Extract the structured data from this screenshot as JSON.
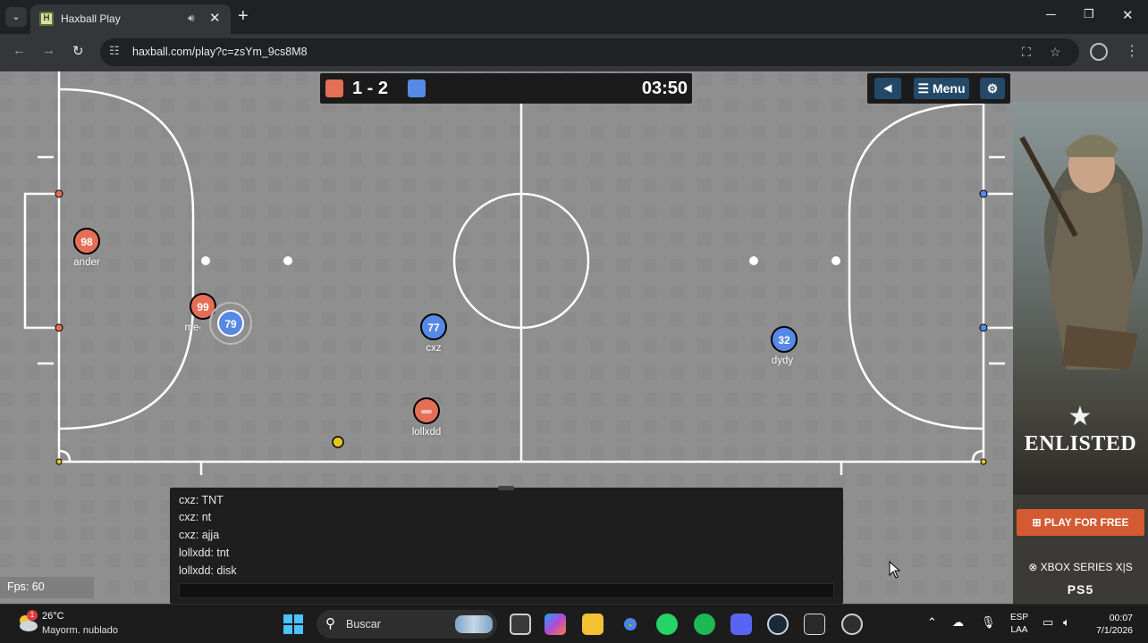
{
  "browser": {
    "tab_title": "Haxball Play",
    "tab_favicon_letter": "H",
    "url": "haxball.com/play?c=zsYm_9cs8M8"
  },
  "game": {
    "score_text": "1 - 2",
    "time": "03:50",
    "menu_label": "Menu",
    "red_color": "#e56e56",
    "blue_color": "#5689e5",
    "ball_color": "#e6c41e",
    "players": [
      {
        "team": "red",
        "number": "98",
        "name": "ander"
      },
      {
        "team": "red",
        "number": "99",
        "name": "mecinh"
      },
      {
        "team": "blue",
        "number": "79",
        "name": ""
      },
      {
        "team": "blue",
        "number": "77",
        "name": "cxz"
      },
      {
        "team": "red",
        "number": "",
        "name": "lollxdd"
      },
      {
        "team": "blue",
        "number": "32",
        "name": "dydy"
      }
    ],
    "chat": [
      "cxz: TNT",
      "cxz: nt",
      "cxz: ajja",
      "lollxdd: tnt",
      "lollxdd: disk"
    ],
    "fps_label": "Fps: 60"
  },
  "ad": {
    "title": "ENLISTED",
    "cta": "PLAY FOR FREE",
    "platform1": "XBOX SERIES X|S",
    "platform2": "PS5"
  },
  "taskbar": {
    "weather_temp": "26°C",
    "weather_desc": "Mayorm. nublado",
    "weather_badge": "1",
    "search_label": "Buscar",
    "lang_line1": "ESP",
    "lang_line2": "LAA",
    "time": "00:07",
    "date": "7/1/2026"
  }
}
